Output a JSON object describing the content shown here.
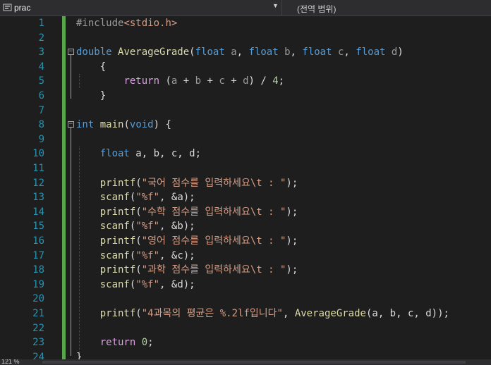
{
  "navbar": {
    "scope_label": "prac",
    "member_label": "(전역 범위)"
  },
  "code": {
    "lines": [
      {
        "n": "1",
        "tokens": [
          {
            "t": "#include",
            "c": "pp"
          },
          {
            "t": "<stdio.h>",
            "c": "str"
          }
        ]
      },
      {
        "n": "2",
        "tokens": []
      },
      {
        "n": "3",
        "tokens": [
          {
            "t": "double",
            "c": "kw"
          },
          {
            "t": " ",
            "c": ""
          },
          {
            "t": "AverageGrade",
            "c": "fn"
          },
          {
            "t": "(",
            "c": ""
          },
          {
            "t": "float",
            "c": "kw"
          },
          {
            "t": " ",
            "c": ""
          },
          {
            "t": "a",
            "c": "param"
          },
          {
            "t": ", ",
            "c": ""
          },
          {
            "t": "float",
            "c": "kw"
          },
          {
            "t": " ",
            "c": ""
          },
          {
            "t": "b",
            "c": "param"
          },
          {
            "t": ", ",
            "c": ""
          },
          {
            "t": "float",
            "c": "kw"
          },
          {
            "t": " ",
            "c": ""
          },
          {
            "t": "c",
            "c": "param"
          },
          {
            "t": ", ",
            "c": ""
          },
          {
            "t": "float",
            "c": "kw"
          },
          {
            "t": " ",
            "c": ""
          },
          {
            "t": "d",
            "c": "param"
          },
          {
            "t": ")",
            "c": ""
          }
        ]
      },
      {
        "n": "4",
        "tokens": [
          {
            "t": "    {",
            "c": ""
          }
        ]
      },
      {
        "n": "5",
        "tokens": [
          {
            "t": "        ",
            "c": ""
          },
          {
            "t": "return",
            "c": "ctrl"
          },
          {
            "t": " (",
            "c": ""
          },
          {
            "t": "a",
            "c": "param"
          },
          {
            "t": " + ",
            "c": ""
          },
          {
            "t": "b",
            "c": "param"
          },
          {
            "t": " + ",
            "c": ""
          },
          {
            "t": "c",
            "c": "param"
          },
          {
            "t": " + ",
            "c": ""
          },
          {
            "t": "d",
            "c": "param"
          },
          {
            "t": ") / ",
            "c": ""
          },
          {
            "t": "4",
            "c": "num"
          },
          {
            "t": ";",
            "c": ""
          }
        ]
      },
      {
        "n": "6",
        "tokens": [
          {
            "t": "    }",
            "c": ""
          }
        ]
      },
      {
        "n": "7",
        "tokens": []
      },
      {
        "n": "8",
        "tokens": [
          {
            "t": "int",
            "c": "kw"
          },
          {
            "t": " ",
            "c": ""
          },
          {
            "t": "main",
            "c": "fn"
          },
          {
            "t": "(",
            "c": ""
          },
          {
            "t": "void",
            "c": "kw"
          },
          {
            "t": ") {",
            "c": ""
          }
        ]
      },
      {
        "n": "9",
        "tokens": []
      },
      {
        "n": "10",
        "tokens": [
          {
            "t": "    ",
            "c": ""
          },
          {
            "t": "float",
            "c": "kw"
          },
          {
            "t": " a, b, c, d;",
            "c": ""
          }
        ]
      },
      {
        "n": "11",
        "tokens": []
      },
      {
        "n": "12",
        "tokens": [
          {
            "t": "    ",
            "c": ""
          },
          {
            "t": "printf",
            "c": "fn"
          },
          {
            "t": "(",
            "c": ""
          },
          {
            "t": "\"국어 점수를 입력하세요\\t : \"",
            "c": "str"
          },
          {
            "t": ");",
            "c": ""
          }
        ]
      },
      {
        "n": "13",
        "tokens": [
          {
            "t": "    ",
            "c": ""
          },
          {
            "t": "scanf",
            "c": "fn"
          },
          {
            "t": "(",
            "c": ""
          },
          {
            "t": "\"%f\"",
            "c": "str"
          },
          {
            "t": ", &a);",
            "c": ""
          }
        ]
      },
      {
        "n": "14",
        "tokens": [
          {
            "t": "    ",
            "c": ""
          },
          {
            "t": "printf",
            "c": "fn"
          },
          {
            "t": "(",
            "c": ""
          },
          {
            "t": "\"수학 점수를 입력하세요\\t : \"",
            "c": "str"
          },
          {
            "t": ");",
            "c": ""
          }
        ]
      },
      {
        "n": "15",
        "tokens": [
          {
            "t": "    ",
            "c": ""
          },
          {
            "t": "scanf",
            "c": "fn"
          },
          {
            "t": "(",
            "c": ""
          },
          {
            "t": "\"%f\"",
            "c": "str"
          },
          {
            "t": ", &b);",
            "c": ""
          }
        ]
      },
      {
        "n": "16",
        "tokens": [
          {
            "t": "    ",
            "c": ""
          },
          {
            "t": "printf",
            "c": "fn"
          },
          {
            "t": "(",
            "c": ""
          },
          {
            "t": "\"영어 점수를 입력하세요\\t : \"",
            "c": "str"
          },
          {
            "t": ");",
            "c": ""
          }
        ]
      },
      {
        "n": "17",
        "tokens": [
          {
            "t": "    ",
            "c": ""
          },
          {
            "t": "scanf",
            "c": "fn"
          },
          {
            "t": "(",
            "c": ""
          },
          {
            "t": "\"%f\"",
            "c": "str"
          },
          {
            "t": ", &c);",
            "c": ""
          }
        ]
      },
      {
        "n": "18",
        "tokens": [
          {
            "t": "    ",
            "c": ""
          },
          {
            "t": "printf",
            "c": "fn"
          },
          {
            "t": "(",
            "c": ""
          },
          {
            "t": "\"과학 점수를 입력하세요\\t : \"",
            "c": "str"
          },
          {
            "t": ");",
            "c": ""
          }
        ]
      },
      {
        "n": "19",
        "tokens": [
          {
            "t": "    ",
            "c": ""
          },
          {
            "t": "scanf",
            "c": "fn"
          },
          {
            "t": "(",
            "c": ""
          },
          {
            "t": "\"%f\"",
            "c": "str"
          },
          {
            "t": ", &d);",
            "c": ""
          }
        ]
      },
      {
        "n": "20",
        "tokens": []
      },
      {
        "n": "21",
        "tokens": [
          {
            "t": "    ",
            "c": ""
          },
          {
            "t": "printf",
            "c": "fn"
          },
          {
            "t": "(",
            "c": ""
          },
          {
            "t": "\"4과목의 평균은 %.2lf입니다\"",
            "c": "str"
          },
          {
            "t": ", ",
            "c": ""
          },
          {
            "t": "AverageGrade",
            "c": "fn"
          },
          {
            "t": "(a, b, c, d));",
            "c": ""
          }
        ]
      },
      {
        "n": "22",
        "tokens": []
      },
      {
        "n": "23",
        "tokens": [
          {
            "t": "    ",
            "c": ""
          },
          {
            "t": "return",
            "c": "ctrl"
          },
          {
            "t": " ",
            "c": ""
          },
          {
            "t": "0",
            "c": "num"
          },
          {
            "t": ";",
            "c": ""
          }
        ]
      },
      {
        "n": "24",
        "tokens": [
          {
            "t": "}",
            "c": ""
          }
        ]
      }
    ]
  },
  "status": {
    "zoom": "121 %"
  }
}
